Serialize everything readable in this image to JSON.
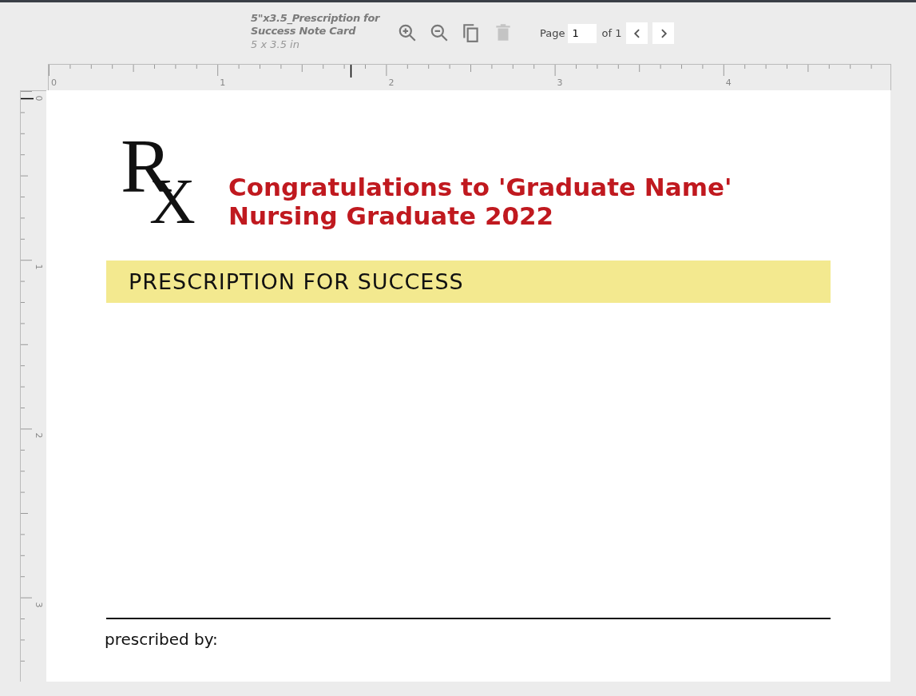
{
  "document": {
    "title": "5\"x3.5_Prescription for Success Note Card",
    "size": "5 x 3.5 in"
  },
  "toolbar": {
    "delete_disabled": true,
    "page_label": "Page",
    "page_value": "1",
    "page_count": "of 1"
  },
  "rulers": {
    "horizontal_labels": [
      "0",
      "1",
      "2",
      "3",
      "4"
    ],
    "vertical_labels": [
      "0",
      "1",
      "2",
      "3"
    ]
  },
  "card": {
    "rx_letters": [
      "R",
      "X"
    ],
    "heading_lines": [
      "Congratulations to 'Graduate Name'",
      "Nursing Graduate 2022"
    ],
    "banner": "PRESCRIPTION FOR SUCCESS",
    "signature_label": "prescribed by:"
  }
}
